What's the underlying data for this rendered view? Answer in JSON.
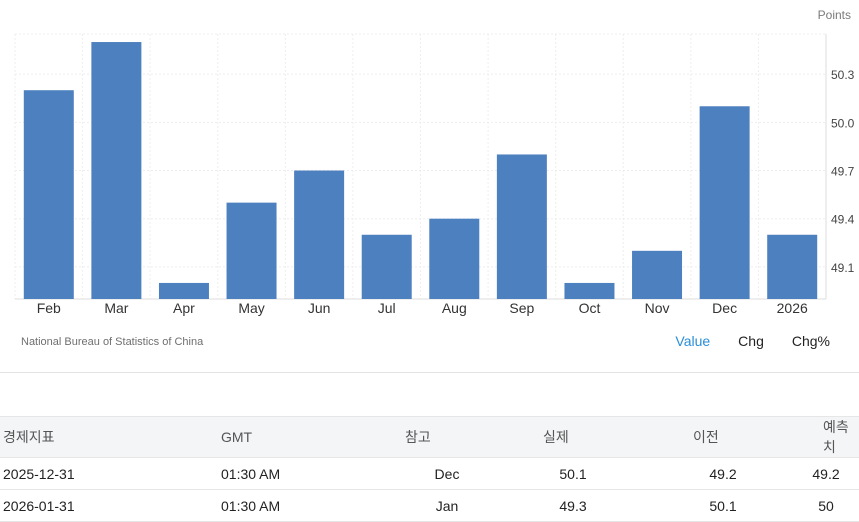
{
  "chart_data": {
    "type": "bar",
    "unit": "Points",
    "categories": [
      "Feb",
      "Mar",
      "Apr",
      "May",
      "Jun",
      "Jul",
      "Aug",
      "Sep",
      "Oct",
      "Nov",
      "Dec",
      "2026"
    ],
    "values": [
      50.2,
      50.5,
      49.0,
      49.5,
      49.7,
      49.3,
      49.4,
      49.8,
      49.0,
      49.2,
      50.1,
      49.3
    ],
    "yticks": [
      49.1,
      49.4,
      49.7,
      50.0,
      50.3
    ],
    "ytick_labels": [
      "49.1",
      "49.4",
      "49.7",
      "50.0",
      "50.3"
    ],
    "ylim": [
      48.9,
      50.55
    ],
    "grid": true,
    "bar_color": "#4d80bf"
  },
  "source": "National Bureau of Statistics of China",
  "tabs": [
    {
      "label": "Value",
      "active": true
    },
    {
      "label": "Chg",
      "active": false
    },
    {
      "label": "Chg%",
      "active": false
    }
  ],
  "table": {
    "headers": [
      "경제지표",
      "GMT",
      "참고",
      "실제",
      "이전",
      "예측치"
    ],
    "rows": [
      [
        "2025-12-31",
        "01:30 AM",
        "Dec",
        "50.1",
        "49.2",
        "49.2"
      ],
      [
        "2026-01-31",
        "01:30 AM",
        "Jan",
        "49.3",
        "50.1",
        "50"
      ]
    ]
  },
  "colors": {
    "accent": "#2a8ed8",
    "bar": "#4d80bf"
  }
}
